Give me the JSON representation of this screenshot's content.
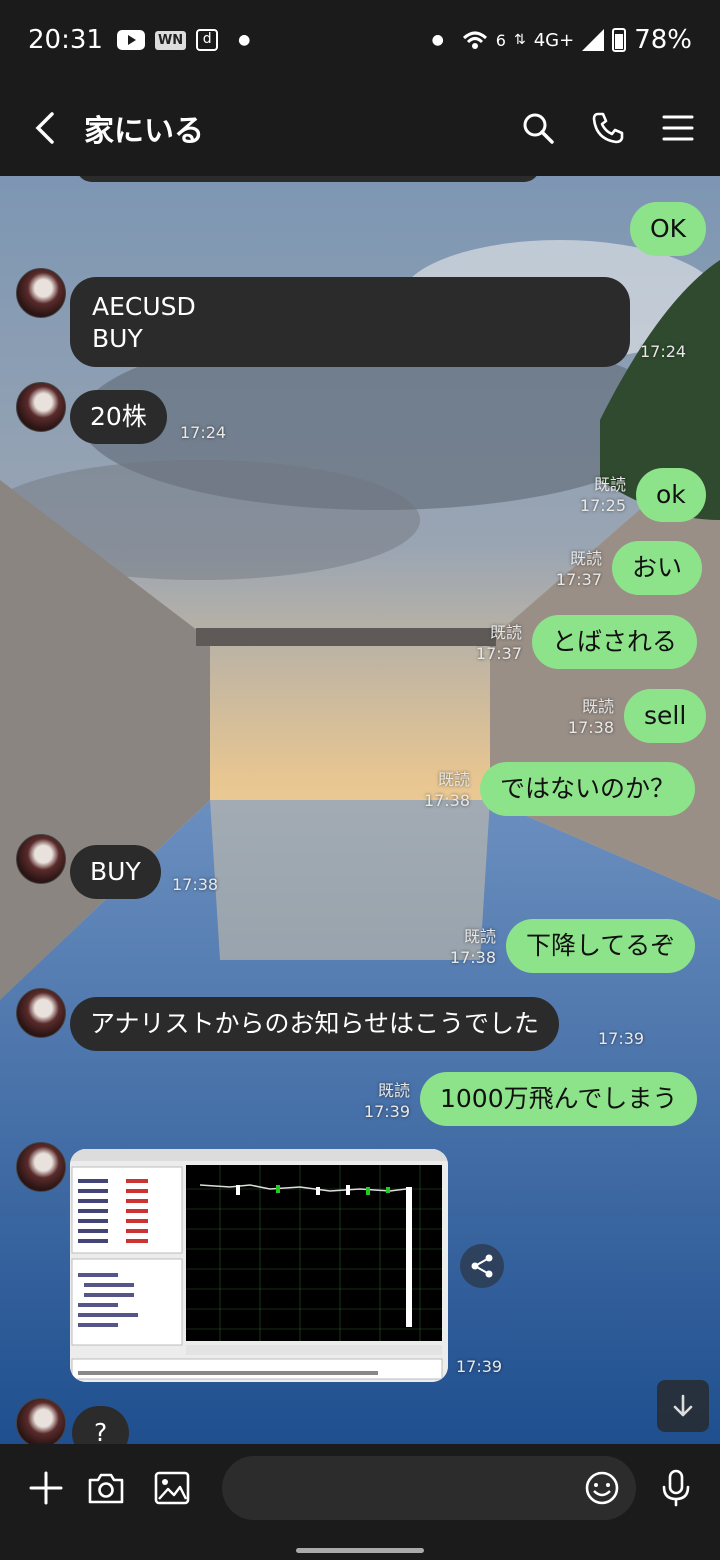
{
  "status_bar": {
    "time": "20:31",
    "network": "4G+",
    "wifi_label": "6",
    "battery": "78%",
    "icons": [
      "youtube-icon",
      "wn-icon",
      "d-icon",
      "dot",
      "dot",
      "wifi-icon",
      "signal-icon",
      "battery-icon"
    ]
  },
  "header": {
    "title": "家にいる",
    "icons": [
      "back-icon",
      "search-icon",
      "phone-icon",
      "menu-icon"
    ]
  },
  "messages": [
    {
      "dir": "out",
      "text": "OK",
      "read": "",
      "time": ""
    },
    {
      "dir": "in",
      "text": "AECUSD\nBUY",
      "time": "17:24"
    },
    {
      "dir": "in",
      "text": "20株",
      "time": "17:24"
    },
    {
      "dir": "out",
      "text": "ok",
      "read": "既読",
      "time": "17:25"
    },
    {
      "dir": "out",
      "text": "おい",
      "read": "既読",
      "time": "17:37"
    },
    {
      "dir": "out",
      "text": "とばされる",
      "read": "既読",
      "time": "17:37"
    },
    {
      "dir": "out",
      "text": "sell",
      "read": "既読",
      "time": "17:38"
    },
    {
      "dir": "out",
      "text": "ではないのか？",
      "read": "既読",
      "time": "17:38"
    },
    {
      "dir": "in",
      "text": "BUY",
      "time": "17:38"
    },
    {
      "dir": "out",
      "text": "下降してるぞ",
      "read": "既読",
      "time": "17:38"
    },
    {
      "dir": "in",
      "text": "アナリストからのお知らせはこうでした",
      "time": "17:39"
    },
    {
      "dir": "out",
      "text": "1000万飛んでしまう",
      "read": "既読",
      "time": "17:39"
    },
    {
      "dir": "in",
      "type": "image",
      "time": "17:39"
    },
    {
      "dir": "in",
      "text": "?",
      "time": ""
    }
  ],
  "input": {
    "placeholder": "",
    "icons": [
      "plus-icon",
      "camera-icon",
      "image-icon",
      "emoji-icon",
      "mic-icon"
    ]
  }
}
